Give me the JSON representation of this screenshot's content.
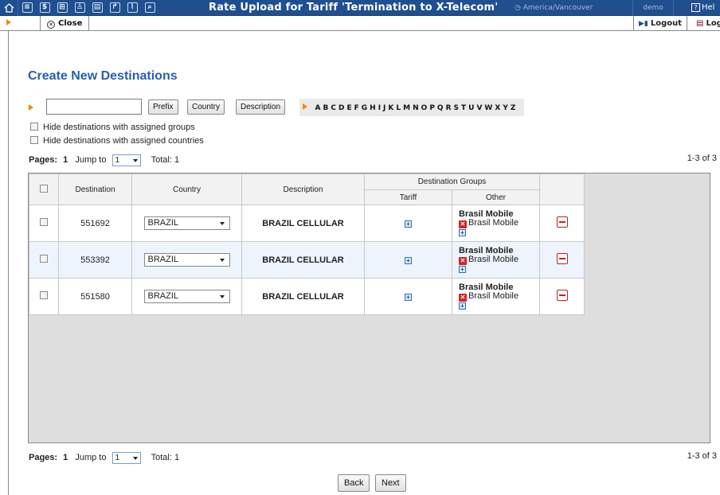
{
  "topbar": {
    "icons": [
      "home-icon",
      "list-icon",
      "dollar-icon",
      "grid-icon",
      "person-icon",
      "table-icon",
      "export-icon",
      "chart-icon",
      "search-icon"
    ],
    "title": "Rate Upload for Tariff 'Termination to X-Telecom'",
    "timezone": "America/Vancouver",
    "user": "demo",
    "help": "Hel"
  },
  "subbar": {
    "close_label": "Close",
    "logout_label": "Logout",
    "log_label": "Log"
  },
  "page": {
    "heading": "Create New Destinations"
  },
  "filter": {
    "search_value": "",
    "buttons": [
      "Prefix",
      "Country",
      "Description"
    ],
    "letters": [
      "A",
      "B",
      "C",
      "D",
      "E",
      "F",
      "G",
      "H",
      "I",
      "J",
      "K",
      "L",
      "M",
      "N",
      "O",
      "P",
      "Q",
      "R",
      "S",
      "T",
      "U",
      "V",
      "W",
      "X",
      "Y",
      "Z"
    ]
  },
  "options": {
    "hide_groups": "Hide destinations with assigned groups",
    "hide_countries": "Hide destinations with assigned countries"
  },
  "pager": {
    "pages_label": "Pages:",
    "current_page": "1",
    "jump_label": "Jump to",
    "jump_value": "1",
    "total_label": "Total: 1",
    "range": "1-3 of 3"
  },
  "table": {
    "headers": {
      "destination": "Destination",
      "country": "Country",
      "description": "Description",
      "groups": "Destination Groups",
      "tariff": "Tariff",
      "other": "Other"
    },
    "rows": [
      {
        "destination": "551692",
        "country": "BRAZIL",
        "description": "BRAZIL CELLULAR",
        "group_name": "Brasil Mobile",
        "group_item": "Brasil Mobile"
      },
      {
        "destination": "553392",
        "country": "BRAZIL",
        "description": "BRAZIL CELLULAR",
        "group_name": "Brasil Mobile",
        "group_item": "Brasil Mobile"
      },
      {
        "destination": "551580",
        "country": "BRAZIL",
        "description": "BRAZIL CELLULAR",
        "group_name": "Brasil Mobile",
        "group_item": "Brasil Mobile"
      }
    ]
  },
  "actions": {
    "back": "Back",
    "next": "Next"
  },
  "colors": {
    "topbar": "#1f4f8f",
    "heading": "#2a5db0",
    "accent_arrow": "#f08a00",
    "alt_row": "#eef4fc",
    "delete": "#c02020"
  }
}
